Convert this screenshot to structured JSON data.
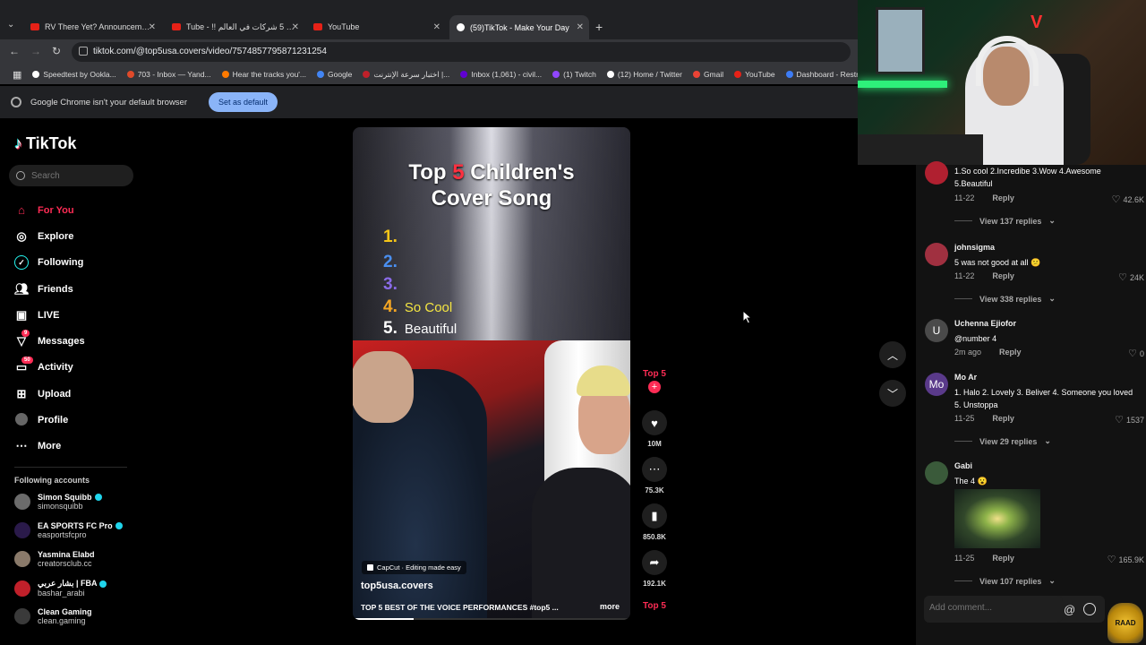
{
  "browser": {
    "tabs": [
      {
        "title": "RV There Yet? Announcement T",
        "active": false
      },
      {
        "title": "Tube - !! أكبر 5 شركات في العالم",
        "active": false
      },
      {
        "title": "YouTube",
        "active": false
      },
      {
        "title": "(59)TikTok - Make Your Day",
        "active": true
      }
    ],
    "url": "tiktok.com/@top5usa.covers/video/7574857795871231254",
    "bookmarks": [
      "Speedtest by Ookla...",
      "703 - Inbox — Yand...",
      "Hear the tracks you'...",
      "Google",
      "اختبار سرعة الإنترنت |...",
      "Inbox (1,061) - civil...",
      "(1) Twitch",
      "(12) Home / Twitter",
      "Gmail",
      "YouTube",
      "Dashboard - Restre..."
    ],
    "infobar": {
      "message": "Google Chrome isn't your default browser",
      "button": "Set as default"
    }
  },
  "tiktok": {
    "logo": "TikTok",
    "search_placeholder": "Search",
    "nav": [
      {
        "label": "For You",
        "icon": "home-icon",
        "active": true
      },
      {
        "label": "Explore",
        "icon": "compass-icon"
      },
      {
        "label": "Following",
        "icon": "following-icon"
      },
      {
        "label": "Friends",
        "icon": "friends-icon"
      },
      {
        "label": "LIVE",
        "icon": "live-icon"
      },
      {
        "label": "Messages",
        "icon": "messages-icon",
        "badge": "9"
      },
      {
        "label": "Activity",
        "icon": "activity-icon",
        "badge": "50"
      },
      {
        "label": "Upload",
        "icon": "upload-icon"
      },
      {
        "label": "Profile",
        "icon": "profile-icon"
      },
      {
        "label": "More",
        "icon": "more-icon"
      }
    ],
    "following_header": "Following accounts",
    "following": [
      {
        "name": "Simon Squibb",
        "handle": "simonsquibb",
        "verified": true
      },
      {
        "name": "EA SPORTS FC Pro",
        "handle": "easportsfcpro",
        "verified": true
      },
      {
        "name": "Yasmina Elabd",
        "handle": "creatorsclub.cc",
        "verified": false
      },
      {
        "name": "بشار عربي | FBA",
        "handle": "bashar_arabi",
        "verified": true
      },
      {
        "name": "Clean Gaming",
        "handle": "clean.gaming",
        "verified": false
      }
    ]
  },
  "video": {
    "title_pre": "Top ",
    "title_num": "5",
    "title_post": " Children's",
    "title_line2": "Cover Song",
    "ranks": [
      {
        "n": "1.",
        "label": "",
        "color": "#f5c518"
      },
      {
        "n": "2.",
        "label": "",
        "color": "#4a8ff0"
      },
      {
        "n": "3.",
        "label": "",
        "color": "#8a6be8"
      },
      {
        "n": "4.",
        "label": "So Cool",
        "color": "#f5a623"
      },
      {
        "n": "5.",
        "label": "Beautiful",
        "color": "#ffffff"
      }
    ],
    "capcut": "CapCut · Editing made easy",
    "author": "top5usa.covers",
    "description": "TOP 5 BEST OF THE VOICE PERFORMANCES #top5 ...",
    "more": "more",
    "progress": 0.22,
    "rail_top": "Top 5",
    "rail_plus": "+",
    "likes": "10M",
    "comments": "75.3K",
    "saves": "850.8K",
    "shares": "192.1K",
    "rail_bottom": "Top 5"
  },
  "comments": [
    {
      "user": "",
      "text": "1.So cool 2.Incredibe 3.Wow 4.Awesome 5.Beautiful",
      "date": "11-22",
      "likes": "42.6K",
      "replies": "View 137 replies",
      "avatar_color": "#b02030"
    },
    {
      "user": "johnsigma",
      "text": "5 was not good at all 😕",
      "date": "11-22",
      "likes": "24K",
      "replies": "View 338 replies",
      "avatar_color": "#a03040"
    },
    {
      "user": "Uchenna Ejiofor",
      "text": "@number 4",
      "date": "2m ago",
      "likes": "0",
      "avatar": "U",
      "avatar_color": "#4a4a4a"
    },
    {
      "user": "Mo Ar",
      "text": "1. Halo 2. Lovely 3. Beliver 4. Someone you loved 5. Unstoppa",
      "date": "11-25",
      "likes": "1537",
      "replies": "View 29 replies",
      "avatar": "Mo",
      "avatar_color": "#5a3a8a"
    },
    {
      "user": "Gabi",
      "text": "The 4 😮",
      "date": "11-25",
      "likes": "165.9K",
      "replies": "View 107 replies",
      "avatar_color": "#3a5a3a"
    }
  ],
  "reply_label": "Reply",
  "comment_placeholder": "Add comment...",
  "stream_logo": "RAAD"
}
